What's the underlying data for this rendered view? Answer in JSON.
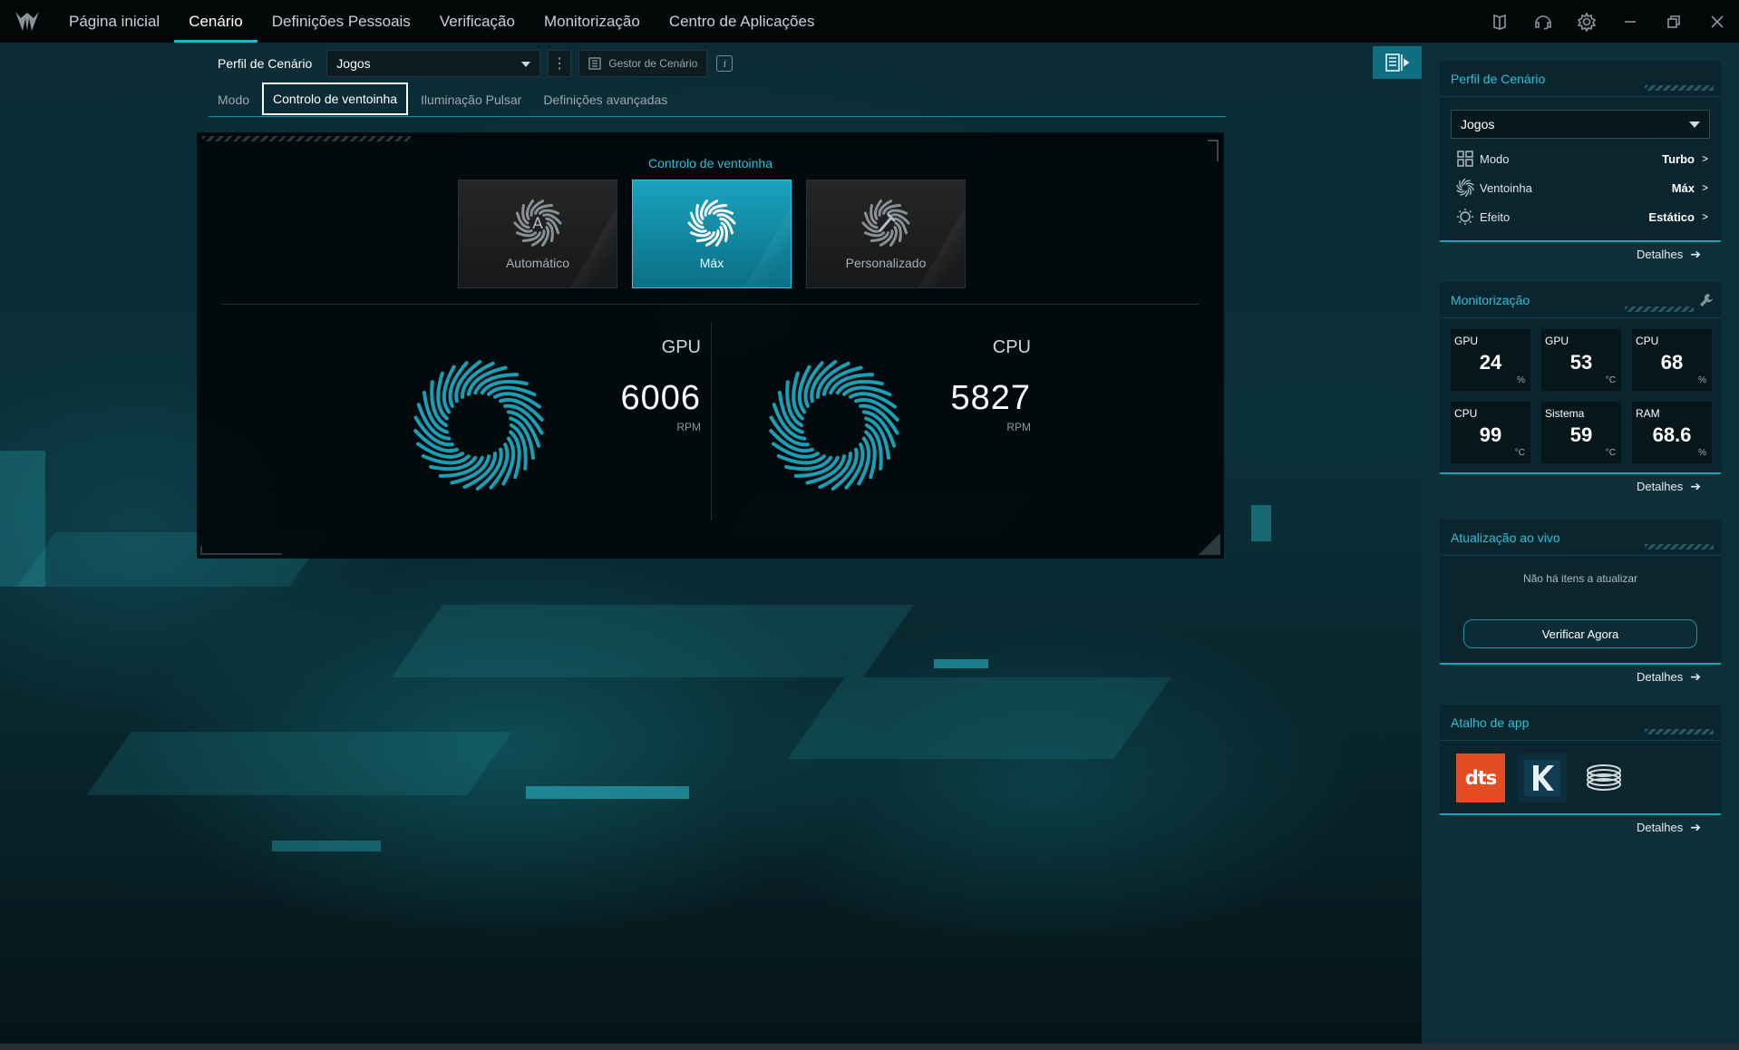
{
  "nav": {
    "items": [
      "Página inicial",
      "Cenário",
      "Definições Pessoais",
      "Verificação",
      "Monitorização",
      "Centro de Aplicações"
    ],
    "active_index": 1
  },
  "profile": {
    "label": "Perfil de Cenário",
    "selected": "Jogos",
    "manager_label": "Gestor de Cenário",
    "info_glyph": "i"
  },
  "subtabs": {
    "items": [
      "Modo",
      "Controlo de ventoinha",
      "Iluminação Pulsar",
      "Definições avançadas"
    ],
    "active_index": 1
  },
  "fan_control": {
    "title": "Controlo de ventoinha",
    "modes": [
      {
        "label": "Automático",
        "icon": "fan-auto-icon"
      },
      {
        "label": "Máx",
        "icon": "fan-max-icon"
      },
      {
        "label": "Personalizado",
        "icon": "fan-custom-icon"
      }
    ],
    "selected_mode": "Máx",
    "fans": [
      {
        "name": "GPU",
        "rpm": "6006",
        "unit": "RPM"
      },
      {
        "name": "CPU",
        "rpm": "5827",
        "unit": "RPM"
      }
    ]
  },
  "sidebar": {
    "profile_card": {
      "title": "Perfil de Cenário",
      "selected": "Jogos",
      "rows": [
        {
          "label": "Modo",
          "value": "Turbo",
          "icon": "grid-icon"
        },
        {
          "label": "Ventoinha",
          "value": "Máx",
          "icon": "fan-icon"
        },
        {
          "label": "Efeito",
          "value": "Estático",
          "icon": "sun-icon"
        }
      ],
      "details": "Detalhes"
    },
    "monitor_card": {
      "title": "Monitorização",
      "tiles": [
        {
          "label": "GPU",
          "value": "24",
          "unit": "%"
        },
        {
          "label": "GPU",
          "value": "53",
          "unit": "°C"
        },
        {
          "label": "CPU",
          "value": "68",
          "unit": "%"
        },
        {
          "label": "CPU",
          "value": "99",
          "unit": "°C"
        },
        {
          "label": "Sistema",
          "value": "59",
          "unit": "°C"
        },
        {
          "label": "RAM",
          "value": "68.6",
          "unit": "%"
        }
      ],
      "details": "Detalhes"
    },
    "live_card": {
      "title": "Atualização ao vivo",
      "message": "Não há itens a atualizar",
      "button": "Verificar Agora",
      "details": "Detalhes"
    },
    "apps_card": {
      "title": "Atalho de app",
      "apps": [
        {
          "name": "dts",
          "text": "dts"
        },
        {
          "name": "killer",
          "text": ""
        },
        {
          "name": "coil",
          "text": ""
        }
      ],
      "details": "Detalhes"
    }
  },
  "colors": {
    "accent": "#1fb6d0",
    "sidebar_bg": "#0c2f38",
    "selected_card": "#1aa2be",
    "dts": "#e24d23"
  }
}
